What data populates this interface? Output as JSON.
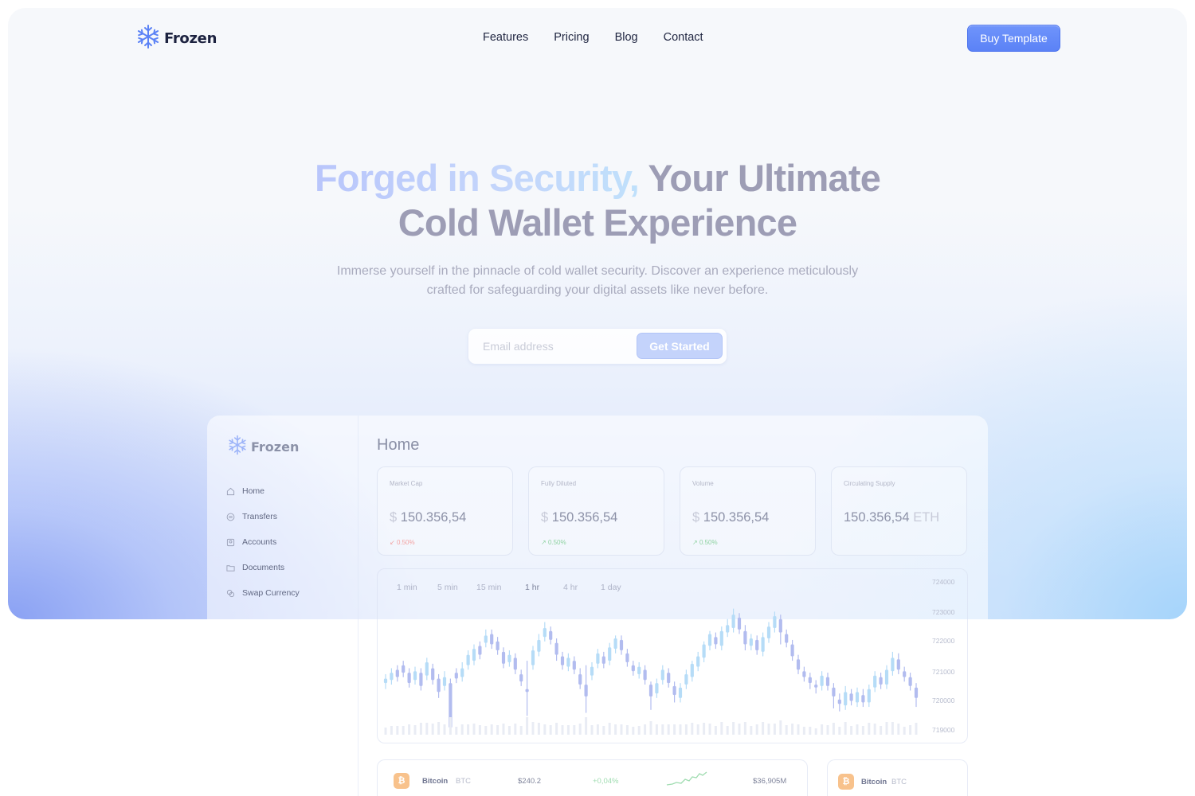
{
  "brand": {
    "name": "Frozen",
    "icon": "snowflake-icon",
    "accent": "#5b82f6"
  },
  "nav": {
    "links": [
      "Features",
      "Pricing",
      "Blog",
      "Contact"
    ],
    "cta": "Buy Template"
  },
  "hero": {
    "headline_highlight": "Forged in Security,",
    "headline_rest": "Your Ultimate",
    "headline_line2": "Cold Wallet Experience",
    "subtitle_line1": "Immerse yourself in the pinnacle of cold wallet security. Discover an experience meticulously",
    "subtitle_line2": "crafted for safeguarding your digital assets like never before.",
    "email_placeholder": "Email address",
    "cta": "Get Started"
  },
  "dashboard": {
    "brand": "Frozen",
    "title": "Home",
    "menu": [
      {
        "label": "Home",
        "icon": "home-icon"
      },
      {
        "label": "Transfers",
        "icon": "transfer-icon"
      },
      {
        "label": "Accounts",
        "icon": "accounts-icon"
      },
      {
        "label": "Documents",
        "icon": "folder-icon"
      },
      {
        "label": "Swap Currency",
        "icon": "swap-icon"
      }
    ],
    "stats": [
      {
        "label": "Market Cap",
        "prefix": "$",
        "value": "150.356,54",
        "suffix": "",
        "change": "0.50%",
        "direction": "down"
      },
      {
        "label": "Fully Diluted",
        "prefix": "$",
        "value": "150.356,54",
        "suffix": "",
        "change": "0.50%",
        "direction": "up"
      },
      {
        "label": "Volume",
        "prefix": "$",
        "value": "150.356,54",
        "suffix": "",
        "change": "0.50%",
        "direction": "up"
      },
      {
        "label": "Circulating Supply",
        "prefix": "",
        "value": "150.356,54",
        "suffix": "ETH",
        "change": "",
        "direction": ""
      }
    ],
    "timeframes": [
      "1 min",
      "5 min",
      "15 min",
      "1 hr",
      "4 hr",
      "1 day"
    ],
    "active_timeframe": "1 hr",
    "assets": [
      {
        "name": "Bitcoin",
        "ticker": "BTC",
        "price": "$240.2",
        "change": "+0,04%",
        "marketcap": "$36,905M"
      },
      {
        "name": "Bitcoin",
        "ticker": "BTC"
      }
    ]
  },
  "chart_data": {
    "type": "candlestick",
    "y_ticks": [
      724000,
      723000,
      722000,
      721000,
      720000,
      719000
    ],
    "ylim": [
      719000,
      724000
    ],
    "candles": [
      [
        720600,
        720750,
        720400,
        720900
      ],
      [
        720700,
        720950,
        720550,
        721100
      ],
      [
        721050,
        720800,
        720650,
        721200
      ],
      [
        721200,
        720950,
        720800,
        721350
      ],
      [
        720950,
        720600,
        720450,
        721100
      ],
      [
        720700,
        721000,
        720550,
        721150
      ],
      [
        720950,
        720500,
        720350,
        721100
      ],
      [
        720850,
        721300,
        720700,
        721450
      ],
      [
        721100,
        720700,
        720550,
        721250
      ],
      [
        720750,
        720300,
        720100,
        720900
      ],
      [
        720500,
        720800,
        720350,
        721000
      ],
      [
        720600,
        719100,
        718900,
        720750
      ],
      [
        720950,
        720750,
        720600,
        721100
      ],
      [
        720800,
        721100,
        720650,
        721300
      ],
      [
        721200,
        721550,
        721050,
        721700
      ],
      [
        721350,
        721750,
        721200,
        721900
      ],
      [
        721850,
        721550,
        721400,
        722000
      ],
      [
        721950,
        722200,
        721800,
        722400
      ],
      [
        722250,
        721900,
        721750,
        722400
      ],
      [
        722000,
        721700,
        721550,
        722150
      ],
      [
        721650,
        721250,
        721100,
        721800
      ],
      [
        721300,
        721550,
        721150,
        721700
      ],
      [
        721450,
        721050,
        720900,
        721600
      ],
      [
        720900,
        720650,
        720500,
        721050
      ],
      [
        720400,
        720300,
        719500,
        721350
      ],
      [
        721200,
        721700,
        721050,
        721850
      ],
      [
        721650,
        722050,
        721500,
        722250
      ],
      [
        722150,
        722450,
        722000,
        722650
      ],
      [
        722350,
        722050,
        721900,
        722500
      ],
      [
        721950,
        721550,
        721350,
        722100
      ],
      [
        721500,
        721200,
        721050,
        721650
      ],
      [
        721150,
        721450,
        721000,
        721600
      ],
      [
        721350,
        721050,
        720900,
        721500
      ],
      [
        720900,
        720550,
        720400,
        721100
      ],
      [
        720550,
        720150,
        719600,
        721200
      ],
      [
        720850,
        721150,
        720700,
        721300
      ],
      [
        721250,
        721600,
        721100,
        721750
      ],
      [
        721500,
        721250,
        721100,
        721650
      ],
      [
        721350,
        721800,
        721200,
        721950
      ],
      [
        721750,
        722100,
        721600,
        722200
      ],
      [
        722050,
        721700,
        721550,
        722200
      ],
      [
        721600,
        721300,
        721150,
        721750
      ],
      [
        721200,
        721000,
        720850,
        721350
      ],
      [
        720900,
        721150,
        720750,
        721300
      ],
      [
        721050,
        720700,
        720550,
        721200
      ],
      [
        720550,
        720150,
        719700,
        720650
      ],
      [
        720250,
        720600,
        720100,
        720750
      ],
      [
        720700,
        721050,
        720550,
        721200
      ],
      [
        720950,
        720600,
        720450,
        721100
      ],
      [
        720500,
        720200,
        719950,
        720650
      ],
      [
        720100,
        720450,
        719950,
        720600
      ],
      [
        720550,
        720900,
        720400,
        721050
      ],
      [
        720800,
        721250,
        720650,
        721350
      ],
      [
        721150,
        721500,
        721000,
        721650
      ],
      [
        721450,
        721900,
        721300,
        722000
      ],
      [
        721850,
        722250,
        721700,
        722350
      ],
      [
        722150,
        721900,
        721750,
        722300
      ],
      [
        721850,
        722350,
        721700,
        722500
      ],
      [
        722300,
        722550,
        722150,
        722750
      ],
      [
        722450,
        722900,
        722300,
        723100
      ],
      [
        722800,
        722400,
        722250,
        722950
      ],
      [
        722350,
        721900,
        721700,
        722550
      ],
      [
        721850,
        722100,
        721700,
        722250
      ],
      [
        722050,
        721700,
        721550,
        722200
      ],
      [
        721650,
        722150,
        721500,
        722300
      ],
      [
        722100,
        722500,
        721950,
        722650
      ],
      [
        722450,
        722850,
        722300,
        723000
      ],
      [
        722750,
        722300,
        721900,
        722900
      ],
      [
        722250,
        721950,
        721800,
        722400
      ],
      [
        721900,
        721500,
        721350,
        722050
      ],
      [
        721400,
        721050,
        720900,
        721550
      ],
      [
        721000,
        720800,
        720650,
        721150
      ],
      [
        720800,
        720600,
        720400,
        720950
      ],
      [
        720550,
        720450,
        720250,
        720700
      ],
      [
        720500,
        720850,
        720350,
        721000
      ],
      [
        720800,
        720500,
        720350,
        720950
      ],
      [
        720450,
        720150,
        719750,
        720600
      ],
      [
        720050,
        719900,
        719650,
        720250
      ],
      [
        719850,
        720300,
        719700,
        720500
      ],
      [
        720250,
        720000,
        719850,
        720400
      ],
      [
        719950,
        720300,
        719800,
        720450
      ],
      [
        720200,
        719950,
        719800,
        720400
      ],
      [
        719950,
        720400,
        719800,
        720550
      ],
      [
        720450,
        720850,
        720300,
        721000
      ],
      [
        720800,
        720550,
        720400,
        720950
      ],
      [
        720550,
        721050,
        720400,
        721200
      ],
      [
        721000,
        721450,
        720850,
        721650
      ],
      [
        721400,
        721050,
        720900,
        721600
      ],
      [
        721000,
        720800,
        720650,
        721150
      ],
      [
        720800,
        720500,
        720350,
        720950
      ],
      [
        720450,
        720100,
        719800,
        720600
      ]
    ]
  }
}
